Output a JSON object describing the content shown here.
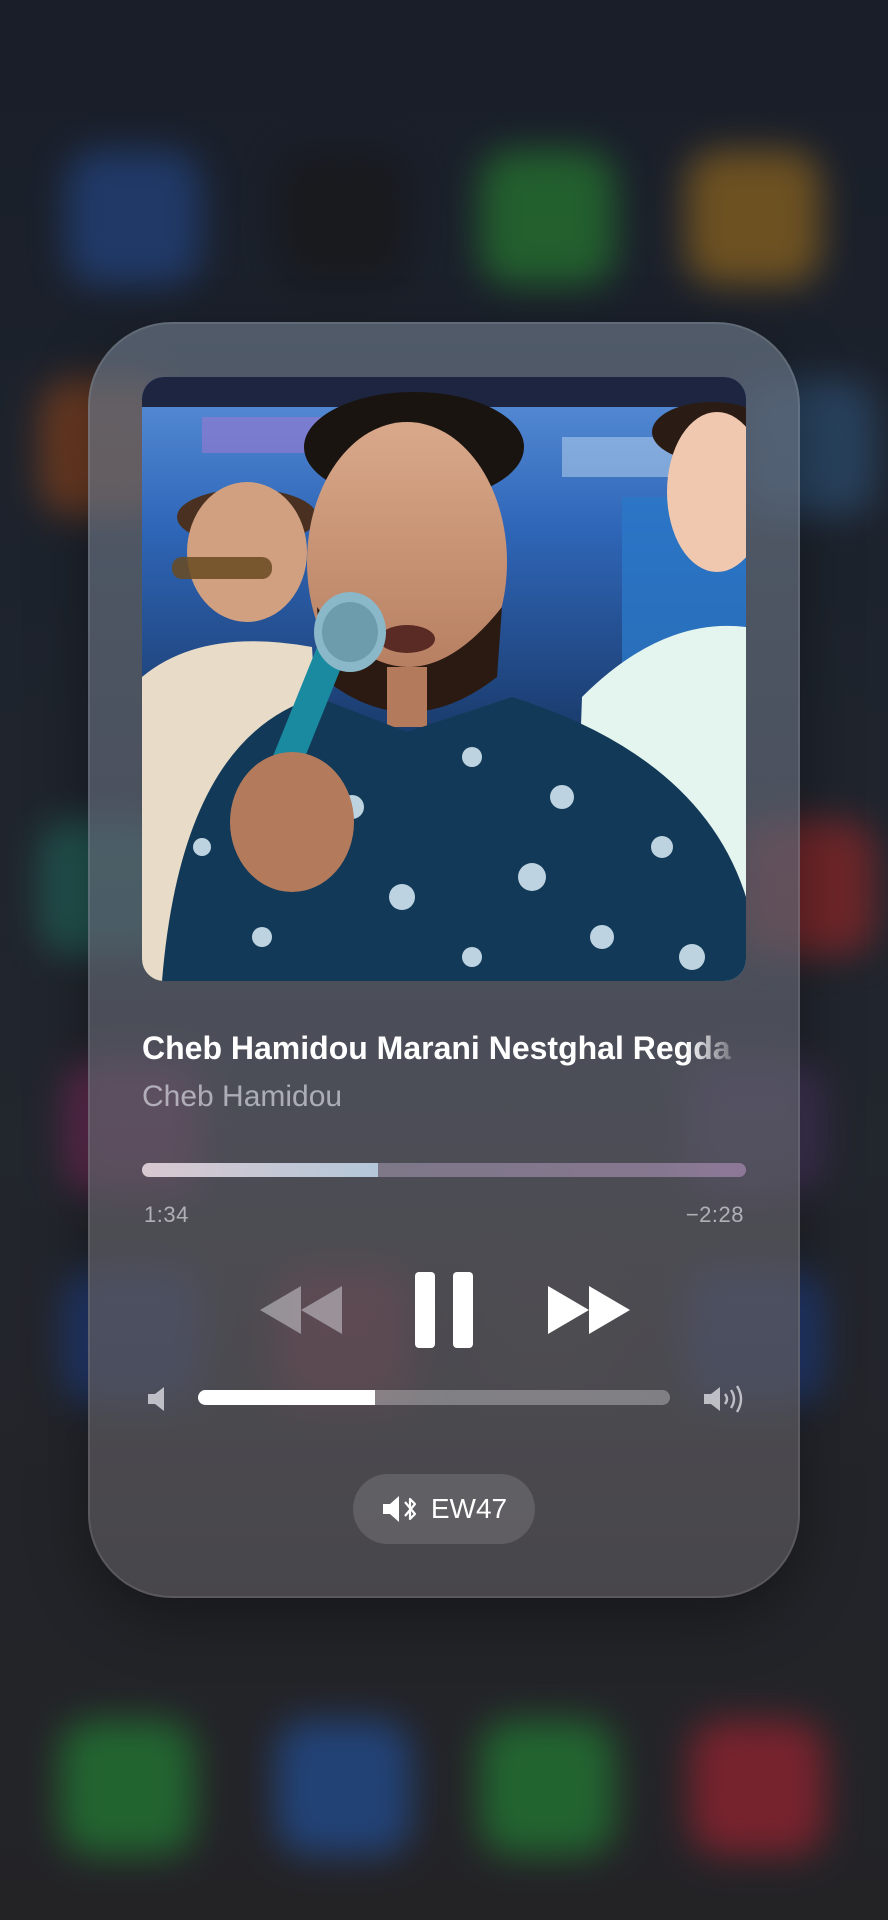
{
  "now_playing": {
    "title": "Cheb Hamidou Marani Nestghal Regda",
    "artist": "Cheb Hamidou",
    "elapsed": "1:34",
    "remaining": "−2:28",
    "progress_fraction": 0.39
  },
  "volume": {
    "level_fraction": 0.375
  },
  "route": {
    "device_name": "EW47",
    "icon": "speaker-bluetooth-icon"
  },
  "controls": {
    "rewind_icon": "rewind-icon",
    "pause_icon": "pause-icon",
    "forward_icon": "fast-forward-icon"
  },
  "colors": {
    "card_tint": "#64707f",
    "accent_text": "#ffffff",
    "secondary_text": "#e6e8f0"
  }
}
